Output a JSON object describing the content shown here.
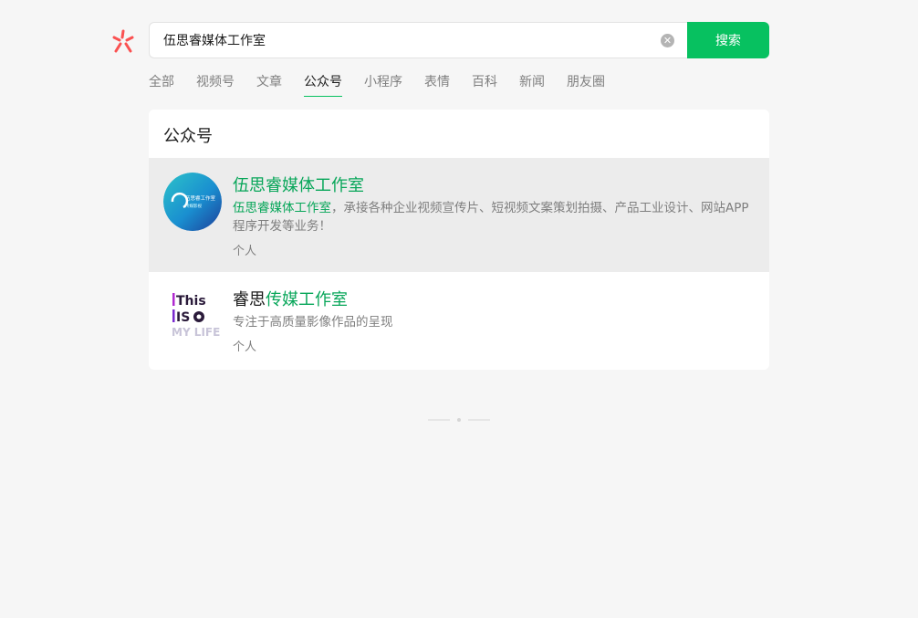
{
  "search": {
    "value": "伍思睿媒体工作室",
    "button_label": "搜索",
    "clear_icon": "close-circle-icon"
  },
  "tabs": [
    {
      "label": "全部",
      "active": false
    },
    {
      "label": "视频号",
      "active": false
    },
    {
      "label": "文章",
      "active": false
    },
    {
      "label": "公众号",
      "active": true
    },
    {
      "label": "小程序",
      "active": false
    },
    {
      "label": "表情",
      "active": false
    },
    {
      "label": "百科",
      "active": false
    },
    {
      "label": "新闻",
      "active": false
    },
    {
      "label": "朋友圈",
      "active": false
    }
  ],
  "results": {
    "section_title": "公众号",
    "items": [
      {
        "name_highlight": "伍思睿媒体工作室",
        "name_rest": "",
        "desc_highlight": "伍思睿媒体工作室",
        "desc_rest": "，承接各种企业视频宣传片、短视频文案策划拍摄、产品工业设计、网站APP程序开发等业务！",
        "type": "个人",
        "avatar_text_1": "伍思睿工作室",
        "avatar_text_2": "传媒影视"
      },
      {
        "name_plain": "睿思",
        "name_highlight": "传媒工作室",
        "desc": "专注于高质量影像作品的呈现",
        "type": "个人",
        "avatar_text_1": "This",
        "avatar_text_2": "IS",
        "avatar_text_3": "MY LIFE"
      }
    ]
  },
  "colors": {
    "accent": "#07c160",
    "highlight": "#07a659",
    "background": "#f6f6f6"
  }
}
